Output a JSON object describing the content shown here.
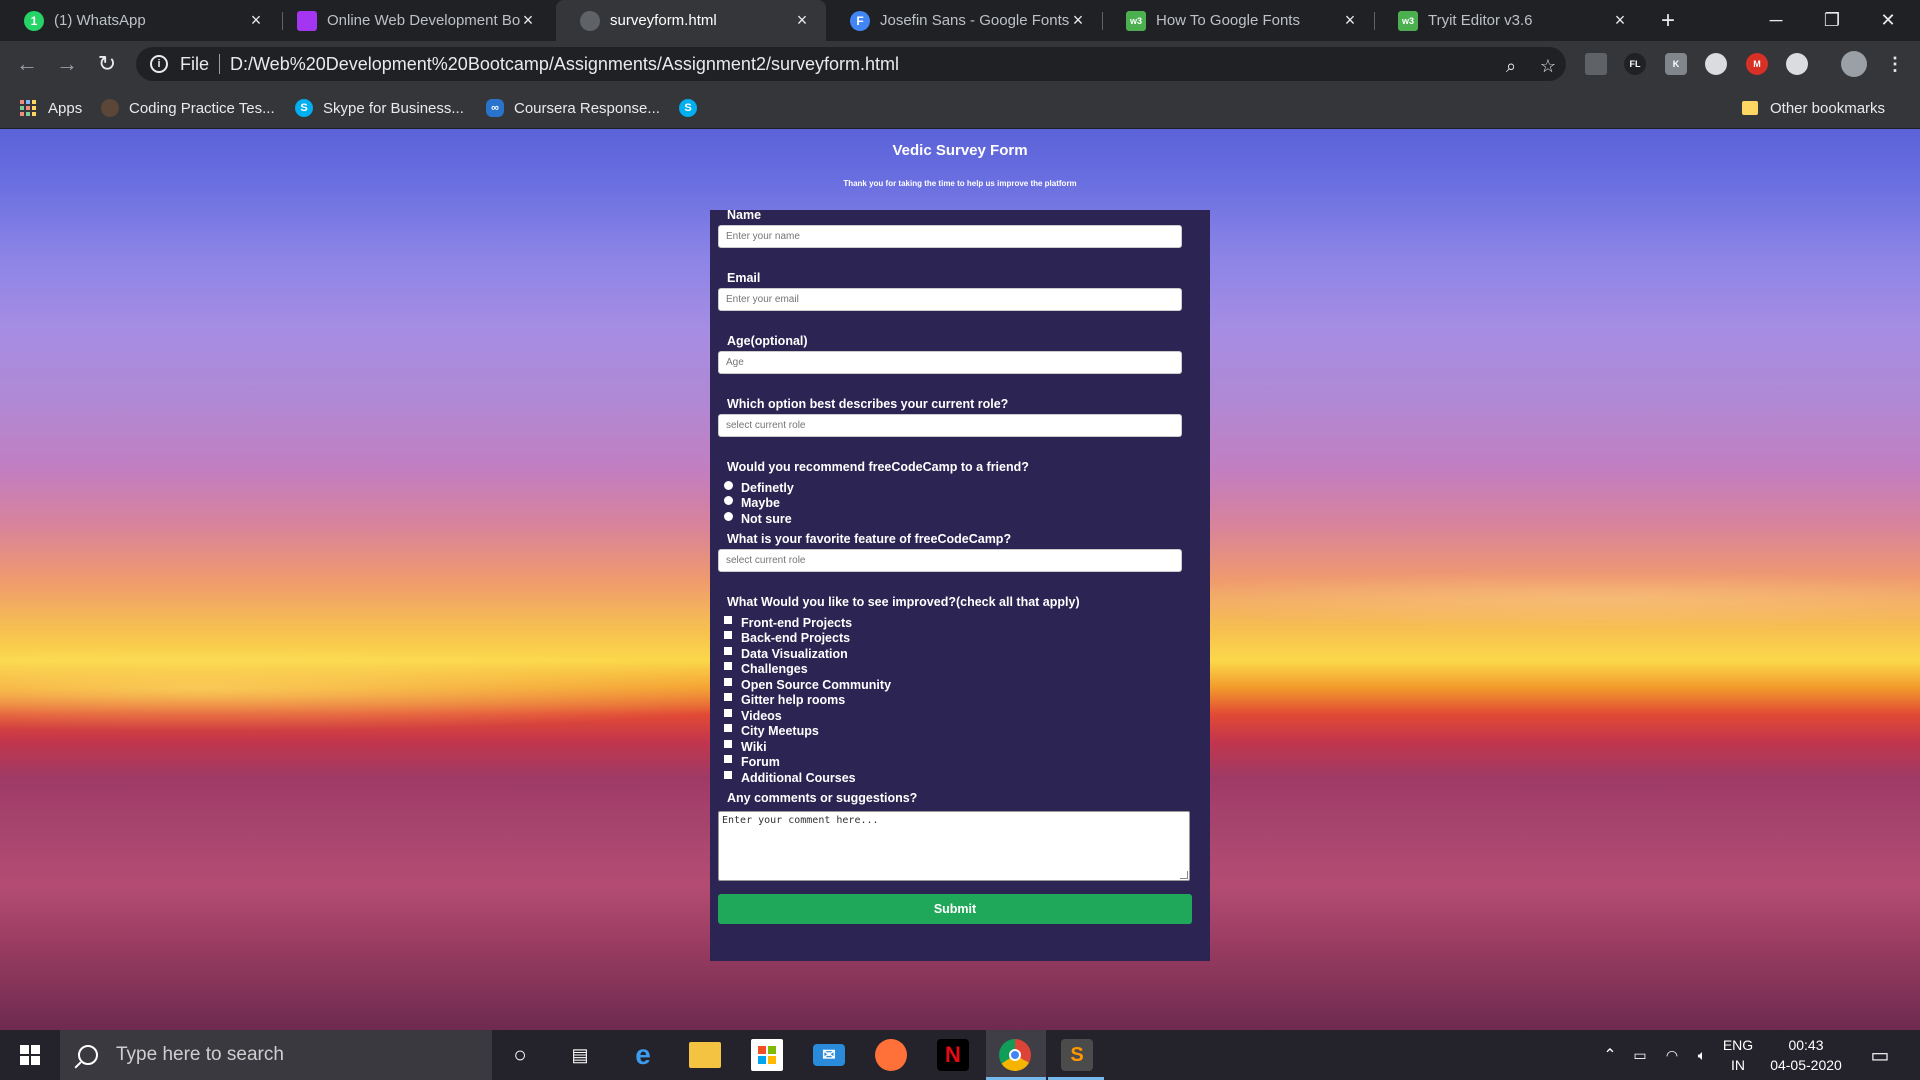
{
  "browser": {
    "tabs": [
      {
        "title": "(1) WhatsApp",
        "icon": "whatsapp-icon",
        "icon_color": "#25d366"
      },
      {
        "title": "Online Web Development Bo",
        "icon": "udemy-icon",
        "icon_color": "#a435f0"
      },
      {
        "title": "surveyform.html",
        "icon": "globe-icon",
        "icon_color": "#5f6368",
        "active": true
      },
      {
        "title": "Josefin Sans - Google Fonts",
        "icon": "google-fonts-icon",
        "icon_color": "#4285f4"
      },
      {
        "title": "How To Google Fonts",
        "icon": "w3schools-icon",
        "icon_color": "#4caf50"
      },
      {
        "title": "Tryit Editor v3.6",
        "icon": "w3schools-icon",
        "icon_color": "#4caf50"
      }
    ],
    "new_tab_symbol": "+",
    "window_controls": {
      "minimize": "─",
      "restore": "❐",
      "close": "✕"
    },
    "address": {
      "scheme": "File",
      "url": "D:/Web%20Development%20Bootcamp/Assignments/Assignment2/surveyform.html"
    },
    "toolbar_icons": [
      "back-icon",
      "forward-icon",
      "reload-icon",
      "zoom-icon",
      "star-icon"
    ],
    "extensions": [
      {
        "name": "reader-extension-icon",
        "label": "",
        "color": "#5f6368"
      },
      {
        "name": "fl-extension-icon",
        "label": "FL",
        "color": "#202124"
      },
      {
        "name": "k-extension-icon",
        "label": "K",
        "color": "#80868b"
      },
      {
        "name": "block-extension-icon",
        "label": "",
        "color": "#dadce0"
      },
      {
        "name": "mcafee-extension-icon",
        "label": "M",
        "color": "#d93025"
      },
      {
        "name": "grammar-extension-icon",
        "label": "",
        "color": "#dadce0"
      },
      {
        "name": "profile-avatar",
        "label": "",
        "color": "#9aa0a6"
      }
    ],
    "bookmarks": [
      {
        "label": "Apps",
        "icon": "apps-grid-icon"
      },
      {
        "label": "Coding Practice Tes...",
        "icon": "codechef-icon",
        "color": "#5b4638"
      },
      {
        "label": "Skype for Business...",
        "icon": "skype-icon",
        "color": "#00aff0"
      },
      {
        "label": "Coursera Response...",
        "icon": "coursera-icon",
        "color": "#2a73cc"
      },
      {
        "label": "",
        "icon": "skype-icon",
        "color": "#00aff0"
      }
    ],
    "other_bookmarks": "Other bookmarks"
  },
  "page": {
    "title": "Vedic Survey Form",
    "subtitle": "Thank you for taking the time to help us improve the platform",
    "form": {
      "name_label": "Name",
      "name_placeholder": "Enter your name",
      "email_label": "Email",
      "email_placeholder": "Enter your email",
      "age_label": "Age(optional)",
      "age_placeholder": "Age",
      "role_label": "Which option best describes your current role?",
      "role_selected": "select current role",
      "recommend_label": "Would you recommend freeCodeCamp to a friend?",
      "recommend_options": [
        "Definetly",
        "Maybe",
        "Not sure"
      ],
      "feature_label": "What is your favorite feature of freeCodeCamp?",
      "feature_selected": "select current role",
      "improve_label": "What Would you like to see improved?(check all that apply)",
      "improve_options": [
        "Front-end Projects",
        "Back-end Projects",
        "Data Visualization",
        "Challenges",
        "Open Source Community",
        "Gitter help rooms",
        "Videos",
        "City Meetups",
        "Wiki",
        "Forum",
        "Additional Courses"
      ],
      "comments_label": "Any comments or suggestions?",
      "comments_placeholder": "Enter your comment here...",
      "submit_label": "Submit"
    }
  },
  "taskbar": {
    "search_placeholder": "Type here to search",
    "apps": [
      {
        "name": "cortana-icon"
      },
      {
        "name": "task-view-icon"
      },
      {
        "name": "edge-icon"
      },
      {
        "name": "file-explorer-icon"
      },
      {
        "name": "store-icon"
      },
      {
        "name": "mail-icon"
      },
      {
        "name": "firefox-icon"
      },
      {
        "name": "netflix-icon",
        "label": "N"
      },
      {
        "name": "chrome-icon",
        "active": true
      },
      {
        "name": "sublime-icon",
        "label": "S"
      }
    ],
    "tray": {
      "language_top": "ENG",
      "language_bottom": "IN",
      "time": "00:43",
      "date": "04-05-2020"
    }
  },
  "colors": {
    "form_background": "#2c2452",
    "submit_background": "#20a85a",
    "chrome_dark": "#202124",
    "chrome_toolbar": "#35363a"
  }
}
